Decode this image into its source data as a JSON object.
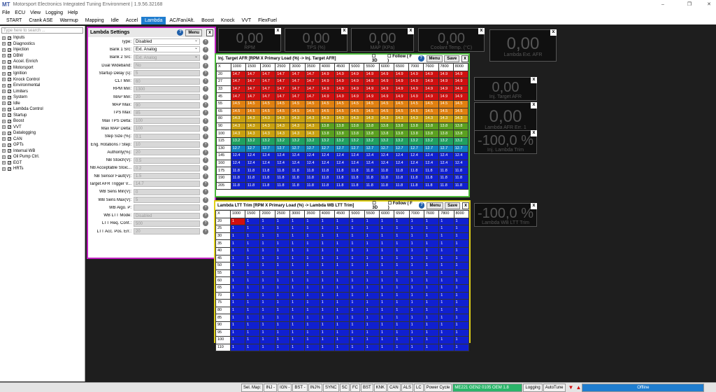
{
  "titlebar": {
    "title": "Motorsport Electronics Integrated Tuning Environment | 1.9.56.32168",
    "logo": "MT"
  },
  "menu": [
    "File",
    "ECU",
    "View",
    "Logging",
    "Help"
  ],
  "tabs": [
    "START",
    "Crank ASE",
    "Warmup",
    "Mapping",
    "Idle",
    "Accel",
    "Lambda",
    "AC/Fan/Alt.",
    "Boost",
    "Knock",
    "VVT",
    "FlexFuel"
  ],
  "active_tab": "Lambda",
  "search_placeholder": "Type here to search ...",
  "tree": [
    "Inputs",
    "Diagnostics",
    "Injection",
    "DBW",
    "Accel. Enrich",
    "Motorsport",
    "Ignition",
    "Knock Control",
    "Environmental",
    "Limiters",
    "System",
    "Idle",
    "Lambda Control",
    "Startup",
    "Boost",
    "VVT",
    "Datalogging",
    "CAN",
    "GPTs",
    "Internal WB",
    "Oil Pump Ctrl.",
    "EGT",
    "HRTs"
  ],
  "lambda_settings": {
    "title": "Lambda Settings",
    "menu_label": "Menu",
    "rows": [
      {
        "label": "Type:",
        "value": "Disabled",
        "enabled": true
      },
      {
        "label": "Bank 1 Src:",
        "value": "Ext. Analog",
        "enabled": true
      },
      {
        "label": "Bank 2 Src:",
        "value": "Ext. Analog",
        "enabled": false
      },
      {
        "label": "Dual Wideband:",
        "value": "No",
        "enabled": false
      },
      {
        "label": "Startup Delay (s):",
        "value": "5",
        "enabled": false
      },
      {
        "label": "CLT Min:",
        "value": "60",
        "enabled": false
      },
      {
        "label": "RPM Min:",
        "value": "1300",
        "enabled": false
      },
      {
        "label": "MAP Min:",
        "value": "20",
        "enabled": false
      },
      {
        "label": "MAP Max:",
        "value": "90",
        "enabled": false
      },
      {
        "label": "TPS Max:",
        "value": "85",
        "enabled": false
      },
      {
        "label": "Max TPS Delta:",
        "value": "100",
        "enabled": false
      },
      {
        "label": "Max MAP Delta:",
        "value": "100",
        "enabled": false
      },
      {
        "label": "Step Size (%):",
        "value": "0.1",
        "enabled": false
      },
      {
        "label": "Eng. Rotations / Step:",
        "value": "10",
        "enabled": false
      },
      {
        "label": "Authority(%):",
        "value": "20",
        "enabled": false
      },
      {
        "label": "NB Stoich(V):",
        "value": "0.5",
        "enabled": false
      },
      {
        "label": "NB Acceptable Stoic...",
        "value": "0.2",
        "enabled": false
      },
      {
        "label": "NB Sensor Fault(V):",
        "value": "1.5",
        "enabled": false
      },
      {
        "label": "Target AFR Trigger V...",
        "value": "14.7",
        "enabled": false
      },
      {
        "label": "WB Sens Min(V):",
        "value": "0",
        "enabled": false
      },
      {
        "label": "WB Sens Max(V):",
        "value": "5",
        "enabled": false
      },
      {
        "label": "WB Algo. P:",
        "value": "",
        "enabled": false
      },
      {
        "label": "WB LTT Mode:",
        "value": "Disabled",
        "enabled": false
      },
      {
        "label": "LTT Req. Conf.:",
        "value": "500",
        "enabled": false
      },
      {
        "label": "LTT Acc. Pos. Err.:",
        "value": "20",
        "enabled": false
      }
    ]
  },
  "gauges": [
    {
      "value": "0,00",
      "label": "RPM"
    },
    {
      "value": "0,00",
      "label": "TPS (%)"
    },
    {
      "value": "0,00",
      "label": "MAP (KPa)"
    },
    {
      "value": "0,00",
      "label": "Coolant Temp. (°C)"
    },
    {
      "value": "0,00",
      "label": "Lambda Ext. AFR"
    },
    {
      "value": "0,00",
      "label": "Inj. Target AFR"
    },
    {
      "value": "0,00",
      "label": "Lambda AFR Err. 1"
    },
    {
      "value": "-100,0 %",
      "label": "Inj. Lambda Trim"
    },
    {
      "value": "-100,0 %",
      "label": "Lambda WB LTT Trim"
    }
  ],
  "afr_table": {
    "title": "Inj. Target AFR  [RPM X Primary Load (%) -> Inj. Target AFR]",
    "opt_3d": "3D",
    "opt_follow": "Follow ( F )",
    "menu_label": "Menu",
    "save_label": "Save",
    "corner": "X",
    "rpm": [
      "1000",
      "1500",
      "2000",
      "2500",
      "3000",
      "3500",
      "4000",
      "4500",
      "5000",
      "5500",
      "6000",
      "6500",
      "7000",
      "7600",
      "7800",
      "8000"
    ],
    "rows": [
      {
        "load": "20",
        "vals": [
          "14.7",
          "14.7",
          "14.7",
          "14.7",
          "14.7",
          "14.7",
          "14.9",
          "14.9",
          "14.9",
          "14.9",
          "14.9",
          "14.9",
          "14.9",
          "14.9",
          "14.9",
          "14.9"
        ]
      },
      {
        "load": "27",
        "vals": [
          "14.7",
          "14.7",
          "14.7",
          "14.7",
          "14.7",
          "14.7",
          "14.9",
          "14.9",
          "14.9",
          "14.9",
          "14.9",
          "14.9",
          "14.9",
          "14.9",
          "14.9",
          "14.9"
        ]
      },
      {
        "load": "33",
        "vals": [
          "14.7",
          "14.7",
          "14.7",
          "14.7",
          "14.7",
          "14.7",
          "14.9",
          "14.9",
          "14.9",
          "14.9",
          "14.9",
          "14.9",
          "14.9",
          "14.9",
          "14.9",
          "14.9"
        ]
      },
      {
        "load": "45",
        "vals": [
          "14.7",
          "14.7",
          "14.7",
          "14.7",
          "14.7",
          "14.7",
          "14.9",
          "14.9",
          "14.9",
          "14.9",
          "14.9",
          "14.9",
          "14.9",
          "14.9",
          "14.9",
          "14.9"
        ]
      },
      {
        "load": "55",
        "vals": [
          "14.5",
          "14.5",
          "14.5",
          "14.5",
          "14.5",
          "14.5",
          "14.5",
          "14.5",
          "14.5",
          "14.5",
          "14.5",
          "14.5",
          "14.5",
          "14.5",
          "14.5",
          "14.5"
        ]
      },
      {
        "load": "65",
        "vals": [
          "14.5",
          "14.5",
          "14.5",
          "14.5",
          "14.5",
          "14.5",
          "14.5",
          "14.5",
          "14.5",
          "14.5",
          "14.5",
          "14.5",
          "14.5",
          "14.5",
          "14.5",
          "14.5"
        ]
      },
      {
        "load": "80",
        "vals": [
          "14.3",
          "14.3",
          "14.3",
          "14.3",
          "14.3",
          "14.3",
          "14.3",
          "14.3",
          "14.3",
          "14.3",
          "14.3",
          "14.3",
          "14.3",
          "14.3",
          "14.3",
          "14.3"
        ]
      },
      {
        "load": "90",
        "vals": [
          "14.3",
          "14.3",
          "14.3",
          "14.3",
          "14.3",
          "14.3",
          "13.8",
          "13.8",
          "13.8",
          "13.8",
          "13.8",
          "13.8",
          "13.8",
          "13.8",
          "13.8",
          "13.8"
        ]
      },
      {
        "load": "100",
        "vals": [
          "14.3",
          "14.3",
          "14.3",
          "14.3",
          "14.3",
          "14.3",
          "13.8",
          "13.8",
          "13.8",
          "13.8",
          "13.8",
          "13.8",
          "13.8",
          "13.8",
          "13.8",
          "13.8"
        ]
      },
      {
        "load": "115",
        "vals": [
          "13.2",
          "13.2",
          "13.2",
          "13.2",
          "13.2",
          "13.2",
          "13.2",
          "13.2",
          "13.2",
          "13.2",
          "13.2",
          "13.2",
          "13.2",
          "13.2",
          "13.2",
          "13.2"
        ]
      },
      {
        "load": "130",
        "vals": [
          "12.7",
          "12.7",
          "12.7",
          "12.7",
          "12.7",
          "12.7",
          "12.7",
          "12.7",
          "12.7",
          "12.7",
          "12.7",
          "12.7",
          "12.7",
          "12.7",
          "12.7",
          "12.7"
        ]
      },
      {
        "load": "145",
        "vals": [
          "12.4",
          "12.4",
          "12.4",
          "12.4",
          "12.4",
          "12.4",
          "12.4",
          "12.4",
          "12.4",
          "12.4",
          "12.4",
          "12.4",
          "12.4",
          "12.4",
          "12.4",
          "12.4"
        ]
      },
      {
        "load": "160",
        "vals": [
          "12.4",
          "12.4",
          "12.4",
          "12.4",
          "12.4",
          "12.4",
          "12.4",
          "12.4",
          "12.4",
          "12.4",
          "12.4",
          "12.4",
          "12.4",
          "12.4",
          "12.4",
          "12.4"
        ]
      },
      {
        "load": "175",
        "vals": [
          "11.8",
          "11.8",
          "11.8",
          "11.8",
          "11.8",
          "11.8",
          "11.8",
          "11.8",
          "11.8",
          "11.8",
          "11.8",
          "11.8",
          "11.8",
          "11.8",
          "11.8",
          "11.8"
        ]
      },
      {
        "load": "190",
        "vals": [
          "11.8",
          "11.8",
          "11.8",
          "11.8",
          "11.8",
          "11.8",
          "11.8",
          "11.8",
          "11.8",
          "11.8",
          "11.8",
          "11.8",
          "11.8",
          "11.8",
          "11.8",
          "11.8"
        ]
      },
      {
        "load": "205",
        "vals": [
          "11.8",
          "11.8",
          "11.8",
          "11.8",
          "11.8",
          "11.8",
          "11.8",
          "11.8",
          "11.8",
          "11.8",
          "11.8",
          "11.8",
          "11.8",
          "11.8",
          "11.8",
          "11.8"
        ]
      }
    ]
  },
  "ltt_table": {
    "title": "Lambda LTT Trim  [RPM X Primary Load (%) -> Lambda WB LTT Trim]",
    "opt_3d": "3D",
    "opt_follow": "Follow ( F )",
    "menu_label": "Menu",
    "save_label": "Save",
    "corner": "X",
    "rpm": [
      "1000",
      "1500",
      "2000",
      "2500",
      "3000",
      "3500",
      "4000",
      "4500",
      "5000",
      "5500",
      "6000",
      "6500",
      "7000",
      "7600",
      "7800",
      "8000"
    ],
    "loads": [
      "20",
      "25",
      "30",
      "35",
      "40",
      "45",
      "50",
      "55",
      "60",
      "65",
      "70",
      "75",
      "80",
      "85",
      "90",
      "95",
      "100",
      "110"
    ],
    "cell": "1"
  },
  "statusbar": [
    "Sel. Map:",
    "INJ -",
    "IGN -",
    "BST -",
    "INJ%",
    "SYNC",
    "SC",
    "FC",
    "BST",
    "KNK",
    "CAN",
    "ALS",
    "LC",
    "Power Cycle",
    "ME221 GEN2 0105 OEM 1.8",
    "Logging",
    "AutoTune",
    "Offline"
  ]
}
